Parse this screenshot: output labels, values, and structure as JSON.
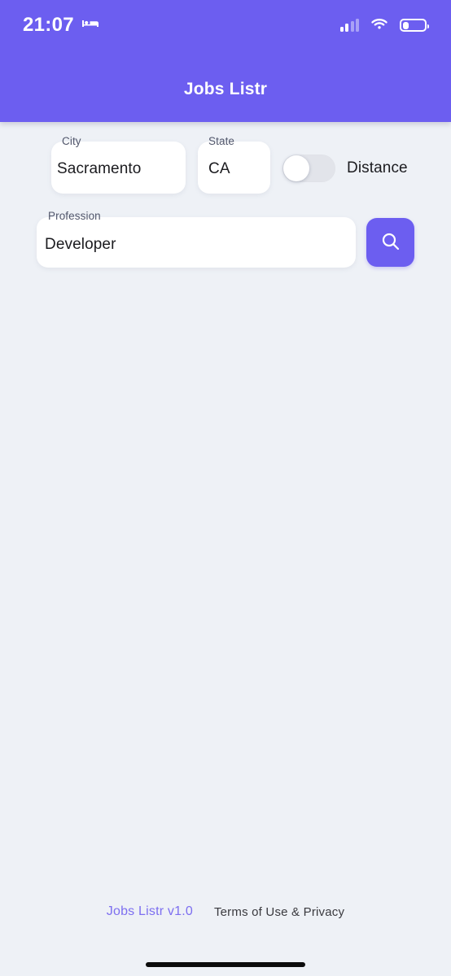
{
  "status_bar": {
    "time": "21:07",
    "sleep_icon": "bed-icon",
    "signal_icon": "cellular-signal-icon",
    "signal_bars_filled": 2,
    "signal_bars_total": 4,
    "wifi_icon": "wifi-icon",
    "battery_icon": "battery-icon",
    "battery_level_percent": 20
  },
  "header": {
    "title": "Jobs Listr",
    "background_color": "#6c5ef0",
    "title_color": "#ffffff"
  },
  "form": {
    "city": {
      "label": "City",
      "value": "Sacramento",
      "placeholder": "City"
    },
    "state": {
      "label": "State",
      "value": "CA",
      "placeholder": "State"
    },
    "distance_toggle": {
      "label": "Distance",
      "checked": false,
      "track_color": "#e2e4ea",
      "knob_color": "#ffffff"
    },
    "profession": {
      "label": "Profession",
      "value": "Developer",
      "placeholder": "Profession"
    },
    "search_button": {
      "icon": "search-icon",
      "background_color": "#6c5ef0"
    }
  },
  "footer": {
    "version": "Jobs Listr v1.0",
    "version_color": "#7d6ff0",
    "terms": "Terms of Use & Privacy",
    "terms_color": "#3a3a3f"
  },
  "page": {
    "background_color": "#eef1f6"
  }
}
